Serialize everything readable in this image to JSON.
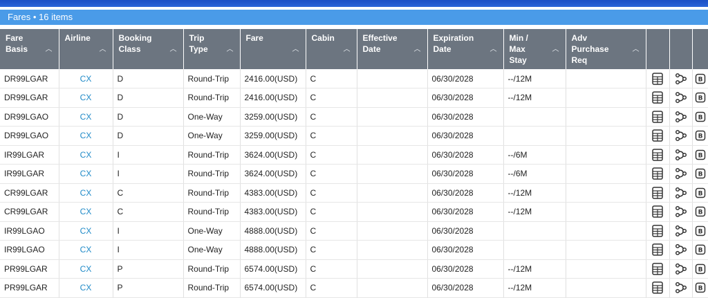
{
  "header": {
    "title": "Fares • 16 items"
  },
  "columns": [
    {
      "label": "Fare\nBasis"
    },
    {
      "label": "Airline"
    },
    {
      "label": "Booking\nClass"
    },
    {
      "label": "Trip\nType"
    },
    {
      "label": "Fare"
    },
    {
      "label": "Cabin"
    },
    {
      "label": "Effective\nDate"
    },
    {
      "label": "Expiration\nDate"
    },
    {
      "label": "Min /\nMax\nStay"
    },
    {
      "label": "Adv\nPurchase\nReq"
    }
  ],
  "rows": [
    [
      "DR99LGAR",
      "CX",
      "D",
      "Round-Trip",
      "2416.00(USD)",
      "C",
      "",
      "06/30/2028",
      "--/12M",
      ""
    ],
    [
      "DR99LGAR",
      "CX",
      "D",
      "Round-Trip",
      "2416.00(USD)",
      "C",
      "",
      "06/30/2028",
      "--/12M",
      ""
    ],
    [
      "DR99LGAO",
      "CX",
      "D",
      "One-Way",
      "3259.00(USD)",
      "C",
      "",
      "06/30/2028",
      "",
      ""
    ],
    [
      "DR99LGAO",
      "CX",
      "D",
      "One-Way",
      "3259.00(USD)",
      "C",
      "",
      "06/30/2028",
      "",
      ""
    ],
    [
      "IR99LGAR",
      "CX",
      "I",
      "Round-Trip",
      "3624.00(USD)",
      "C",
      "",
      "06/30/2028",
      "--/6M",
      ""
    ],
    [
      "IR99LGAR",
      "CX",
      "I",
      "Round-Trip",
      "3624.00(USD)",
      "C",
      "",
      "06/30/2028",
      "--/6M",
      ""
    ],
    [
      "CR99LGAR",
      "CX",
      "C",
      "Round-Trip",
      "4383.00(USD)",
      "C",
      "",
      "06/30/2028",
      "--/12M",
      ""
    ],
    [
      "CR99LGAR",
      "CX",
      "C",
      "Round-Trip",
      "4383.00(USD)",
      "C",
      "",
      "06/30/2028",
      "--/12M",
      ""
    ],
    [
      "IR99LGAO",
      "CX",
      "I",
      "One-Way",
      "4888.00(USD)",
      "C",
      "",
      "06/30/2028",
      "",
      ""
    ],
    [
      "IR99LGAO",
      "CX",
      "I",
      "One-Way",
      "4888.00(USD)",
      "C",
      "",
      "06/30/2028",
      "",
      ""
    ],
    [
      "PR99LGAR",
      "CX",
      "P",
      "Round-Trip",
      "6574.00(USD)",
      "C",
      "",
      "06/30/2028",
      "--/12M",
      ""
    ],
    [
      "PR99LGAR",
      "CX",
      "P",
      "Round-Trip",
      "6574.00(USD)",
      "C",
      "",
      "06/30/2028",
      "--/12M",
      ""
    ]
  ],
  "row_icons": [
    "calculator-icon",
    "route-icon",
    "rules-icon"
  ],
  "colors": {
    "header_bg": "#6c7580",
    "title_bar": "#4a9be8",
    "top_bar": "#1b4fc4",
    "airline_link": "#1f8ac8"
  }
}
